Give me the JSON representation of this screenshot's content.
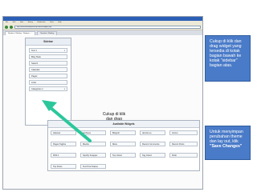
{
  "browser": {
    "title": "Newbie's Weblog - Widgets - WordPress - Mozilla Firefox",
    "menu": [
      "File",
      "Edit",
      "View",
      "History",
      "Bookmarks",
      "Tools",
      "Help"
    ],
    "url": "http://localhost/wordpress/wp-admin/widgets.php",
    "tabs": [
      "Newbie's Weblog - Widgets - ...",
      "Newbie's Weblog"
    ]
  },
  "sidebar": {
    "title": "Sidebar",
    "widgets": [
      "Text 1",
      "Blog Stats",
      "Search",
      "Calendar",
      "Pages",
      "Links",
      "Categories 1"
    ]
  },
  "caption": {
    "line1": "Cukup di klik",
    "line2": "dan drag"
  },
  "available": {
    "title": "Available Widgets",
    "items": [
      "Akismet",
      "Archives",
      "Blogroll",
      "del.icio.us",
      "Gizmo",
      "Flickr",
      "Pages Tagline",
      "Meebo",
      "Meta",
      "Recent Comments",
      "Recent Posts",
      "RSS 1",
      "Spotify Snapper",
      "Top Cloud",
      "Tag Cloud",
      "Top Posts",
      "Text Post Status"
    ]
  },
  "callouts": {
    "top": "Cukup di klik dan drag widget yang tersedia di kotak bagian bawah ke kotak \"sidebar\" bagian atas.",
    "bottom_text": "Untuk menyimpan perubahan theme dan lay out, klik",
    "bottom_bold": "\"Save Changes\""
  },
  "colors": {
    "callout": "#4a7bc8",
    "arrow": "#2bc79b",
    "titlebar": "#2c5fb6"
  }
}
